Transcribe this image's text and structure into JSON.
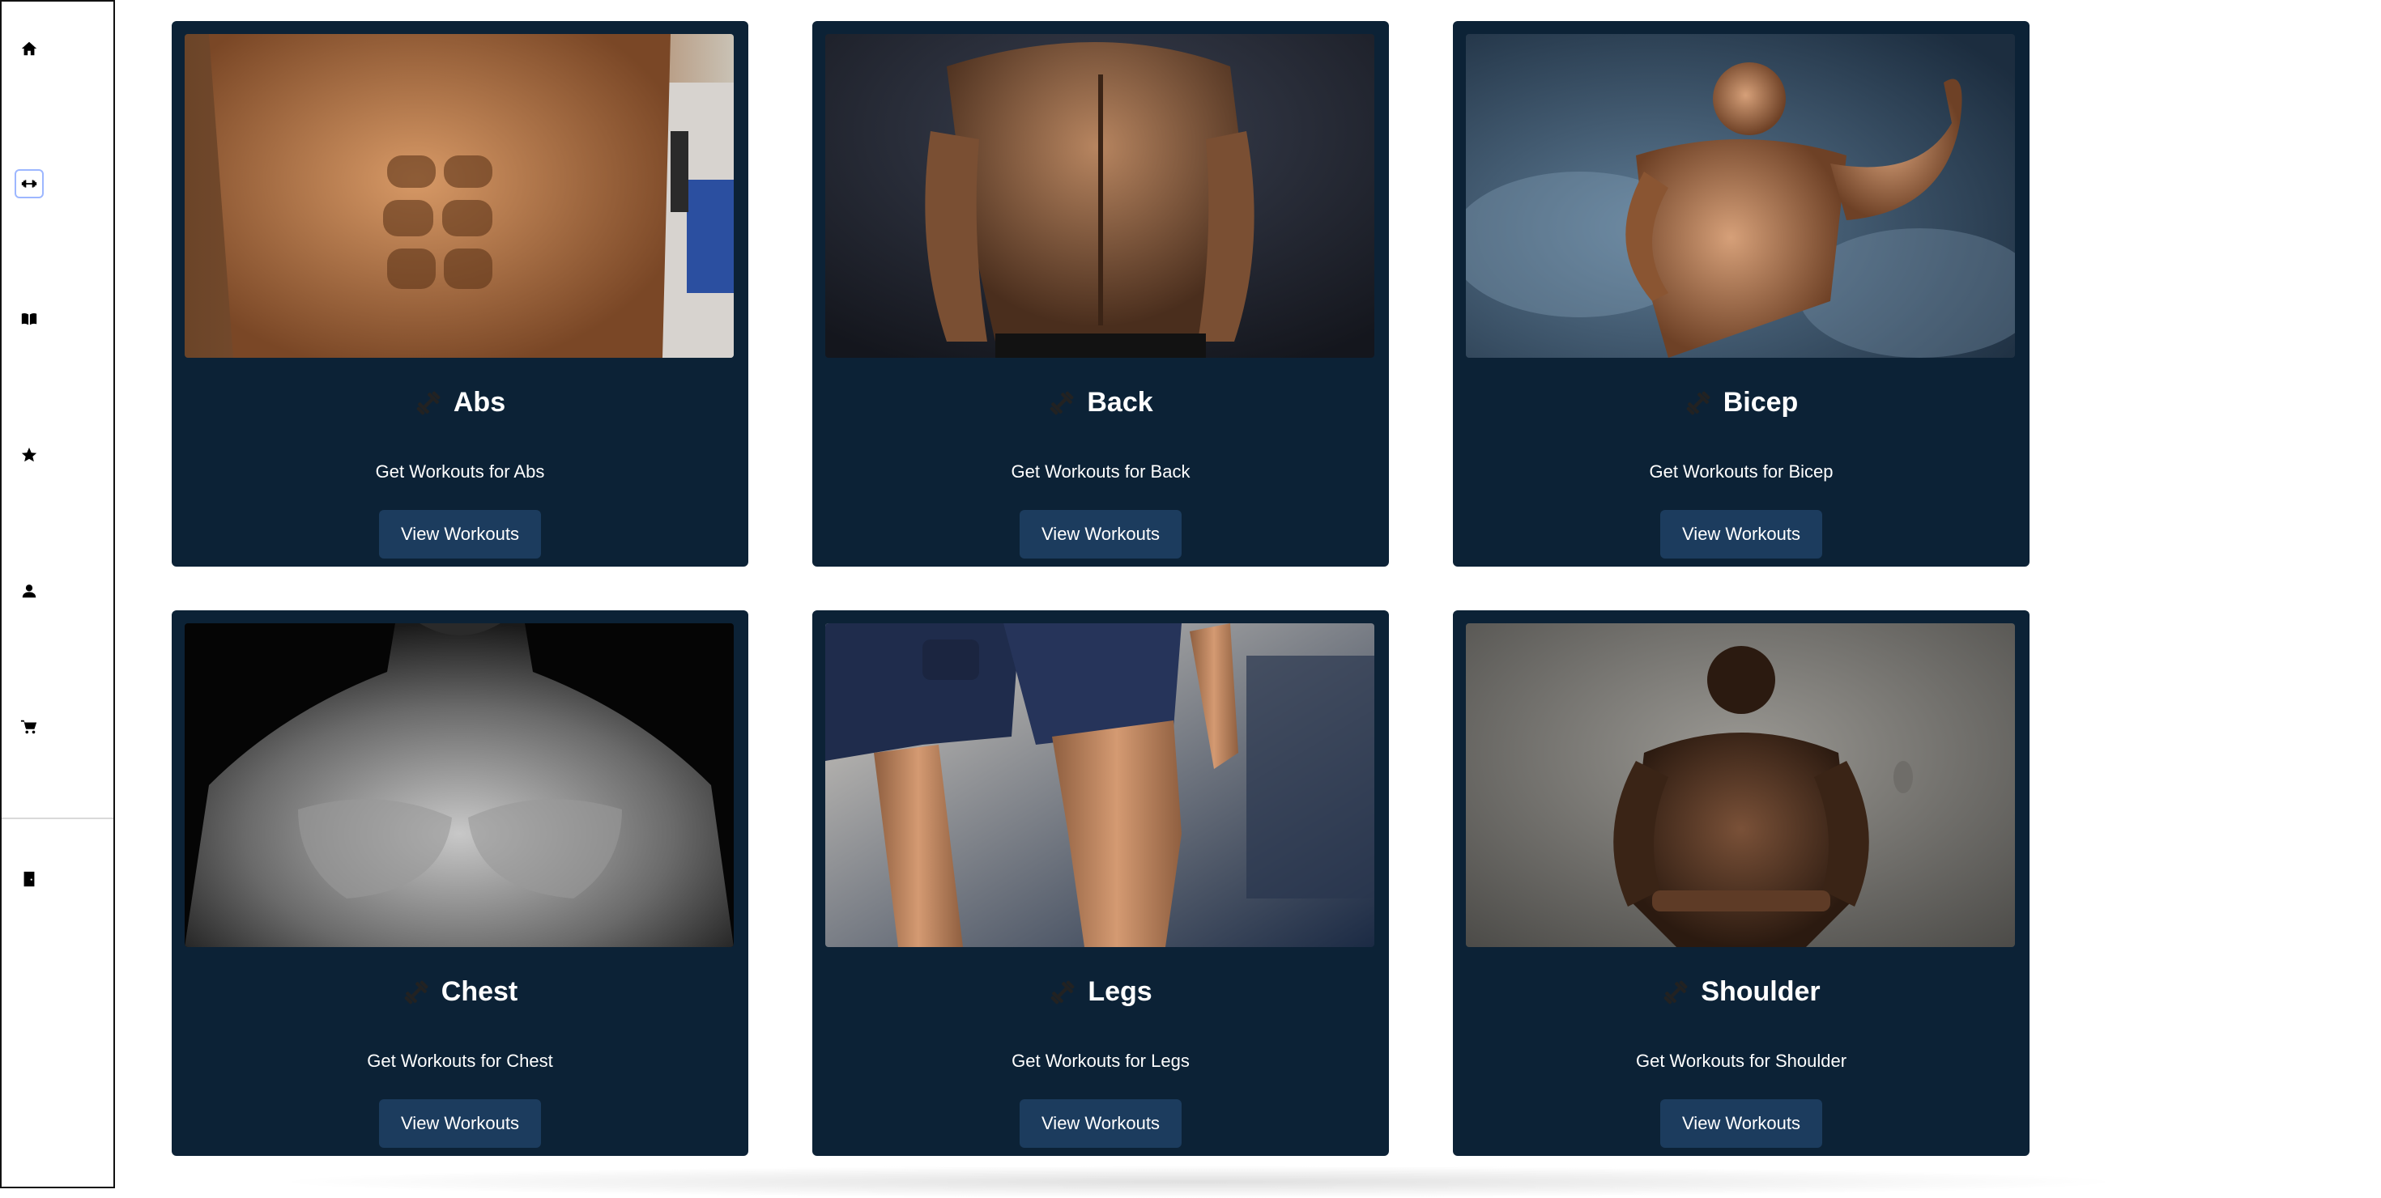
{
  "sidebar": {
    "items": [
      {
        "icon": "home-icon"
      },
      {
        "icon": "dumbbell-icon",
        "active": true
      },
      {
        "icon": "book-icon"
      },
      {
        "icon": "star-icon"
      },
      {
        "icon": "user-icon"
      },
      {
        "icon": "cart-icon"
      },
      {
        "icon": "logout-door-icon"
      }
    ]
  },
  "cards": [
    {
      "title": "Abs",
      "description": "Get Workouts for Abs",
      "button": "View Workouts",
      "image": "abs-photo"
    },
    {
      "title": "Back",
      "description": "Get Workouts for Back",
      "button": "View Workouts",
      "image": "back-photo"
    },
    {
      "title": "Bicep",
      "description": "Get Workouts for Bicep",
      "button": "View Workouts",
      "image": "bicep-photo"
    },
    {
      "title": "Chest",
      "description": "Get Workouts for Chest",
      "button": "View Workouts",
      "image": "chest-photo"
    },
    {
      "title": "Legs",
      "description": "Get Workouts for Legs",
      "button": "View Workouts",
      "image": "legs-photo"
    },
    {
      "title": "Shoulder",
      "description": "Get Workouts for Shoulder",
      "button": "View Workouts",
      "image": "shoulder-photo"
    }
  ],
  "colors": {
    "card_bg": "#0c2236",
    "button_bg": "#1c3c5e",
    "text": "#ffffff"
  }
}
